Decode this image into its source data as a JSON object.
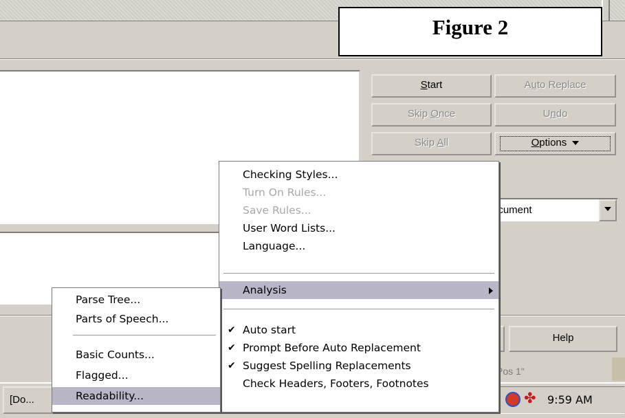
{
  "figure_label": "Figure 2",
  "buttons": {
    "start": {
      "pre": "",
      "key": "S",
      "post": "tart"
    },
    "auto_replace": {
      "pre": "A",
      "key": "u",
      "post": "to Replace"
    },
    "skip_once": {
      "pre": "Skip ",
      "key": "O",
      "post": "nce"
    },
    "undo": {
      "pre": "U",
      "key": "n",
      "post": "do"
    },
    "skip_all": {
      "pre": "Skip ",
      "key": "A",
      "post": "ll"
    },
    "options": {
      "pre": "",
      "key": "O",
      "post": "ptions"
    },
    "help": "Help"
  },
  "document_dropdown_value": "ocument",
  "status_position": "Pos 1\"",
  "taskbar": {
    "task_label": "[Do...",
    "clock": "9:59 AM"
  },
  "options_menu": {
    "items": [
      {
        "label": "Checking Styles...",
        "enabled": true
      },
      {
        "label": "Turn On Rules...",
        "enabled": false
      },
      {
        "label": "Save Rules...",
        "enabled": false
      },
      {
        "label": "User Word Lists...",
        "enabled": true
      },
      {
        "label": "Language...",
        "enabled": true
      },
      {
        "label": "Analysis",
        "enabled": true,
        "highlighted": true,
        "submenu": true
      },
      {
        "label": "Auto start",
        "checked": true
      },
      {
        "label": "Prompt Before Auto Replacement",
        "checked": true
      },
      {
        "label": "Suggest Spelling Replacements",
        "checked": true
      },
      {
        "label": "Check Headers, Footers, Footnotes",
        "checked": false
      }
    ]
  },
  "analysis_submenu": {
    "items": [
      {
        "label": "Parse Tree..."
      },
      {
        "label": "Parts of Speech..."
      },
      {
        "label": "Basic Counts..."
      },
      {
        "label": "Flagged..."
      },
      {
        "label": "Readability...",
        "highlighted": true
      }
    ]
  },
  "colors": {
    "dialog_bg": "#d4d0c8",
    "menu_highlight": "#b9b6c8",
    "disabled_text": "#a9a9a9"
  }
}
